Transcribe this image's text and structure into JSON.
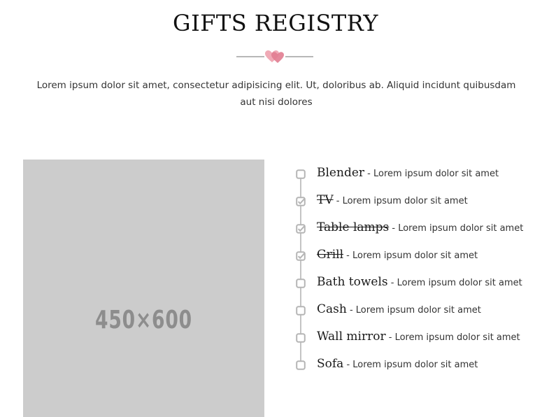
{
  "header": {
    "title": "GIFTS REGISTRY",
    "intro": "Lorem ipsum dolor sit amet, consectetur adipisicing elit. Ut, doloribus ab. Aliquid incidunt quibusdam aut nisi dolores"
  },
  "image": {
    "placeholder_text": "450×600"
  },
  "colors": {
    "heart": "#e8899a",
    "placeholder_bg": "#cccccc",
    "line": "#c4c4c4"
  },
  "registry": {
    "separator": " - ",
    "items": [
      {
        "name": "Blender",
        "description": "Lorem ipsum dolor sit amet",
        "checked": false
      },
      {
        "name": "TV",
        "description": "Lorem ipsum dolor sit amet",
        "checked": true
      },
      {
        "name": "Table lamps",
        "description": "Lorem ipsum dolor sit amet",
        "checked": true
      },
      {
        "name": "Grill",
        "description": "Lorem ipsum dolor sit amet",
        "checked": true
      },
      {
        "name": "Bath towels",
        "description": "Lorem ipsum dolor sit amet",
        "checked": false
      },
      {
        "name": "Cash",
        "description": "Lorem ipsum dolor sit amet",
        "checked": false
      },
      {
        "name": "Wall mirror",
        "description": "Lorem ipsum dolor sit amet",
        "checked": false
      },
      {
        "name": "Sofa",
        "description": "Lorem ipsum dolor sit amet",
        "checked": false
      }
    ]
  }
}
